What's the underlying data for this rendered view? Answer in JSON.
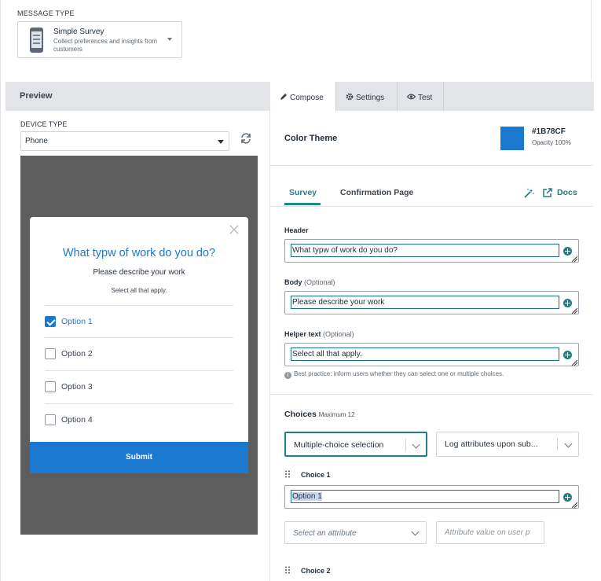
{
  "message_type": {
    "label": "MESSAGE TYPE",
    "selected_title": "Simple Survey",
    "selected_description": "Collect preferences and insights from customers"
  },
  "preview": {
    "title": "Preview",
    "device_type_label": "DEVICE TYPE",
    "device_type_value": "Phone",
    "modal": {
      "header": "What typw of work do you do?",
      "body": "Please describe your work",
      "helper": "Select all that apply.",
      "options": [
        {
          "label": "Option 1",
          "checked": true
        },
        {
          "label": "Option 2",
          "checked": false
        },
        {
          "label": "Option 3",
          "checked": false
        },
        {
          "label": "Option 4",
          "checked": false
        }
      ],
      "submit_label": "Submit"
    }
  },
  "tabs": [
    {
      "label": "Compose",
      "icon": "pencil-icon",
      "active": true
    },
    {
      "label": "Settings",
      "icon": "gear-icon",
      "active": false
    },
    {
      "label": "Test",
      "icon": "eye-icon",
      "active": false
    }
  ],
  "color_theme": {
    "label": "Color Theme",
    "hex": "#1B78CF",
    "opacity": "Opacity 100%",
    "swatch_color": "#1B78CF"
  },
  "subtabs": {
    "survey": "Survey",
    "confirmation": "Confirmation Page",
    "docs": "Docs"
  },
  "fields": {
    "header": {
      "label": "Header",
      "value": "What typw of work do you do?"
    },
    "body": {
      "label": "Body",
      "optional": "(Optional)",
      "value": "Please describe your work"
    },
    "helper": {
      "label": "Helper text",
      "optional": "(Optional)",
      "value": "Select all that apply."
    },
    "best_practice": "Best practice: inform users whether they can select one or multiple choices."
  },
  "choices": {
    "label": "Choices",
    "max": "Maximum 12",
    "selection_type": "Multiple-choice selection",
    "log_attributes": "Log attributes upon sub...",
    "choice1_label": "Choice 1",
    "choice1_value": "Option 1",
    "attribute_placeholder": "Select an attribute",
    "attribute_value_placeholder": "Attribute value on user p",
    "choice2_label": "Choice 2"
  }
}
